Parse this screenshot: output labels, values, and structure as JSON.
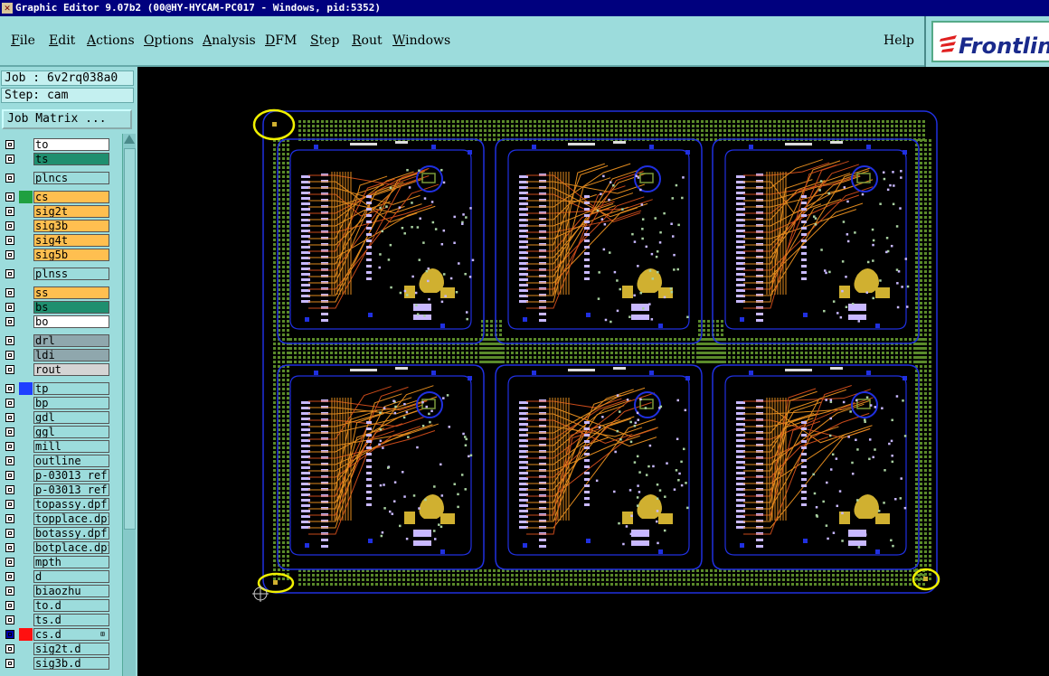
{
  "window": {
    "title": "Graphic Editor 9.07b2 (00@HY-HYCAM-PC017 - Windows, pid:5352)"
  },
  "menu": {
    "items": [
      {
        "label": "File",
        "mnemonic": "F"
      },
      {
        "label": "Edit",
        "mnemonic": "E"
      },
      {
        "label": "Actions",
        "mnemonic": "A"
      },
      {
        "label": "Options",
        "mnemonic": "O"
      },
      {
        "label": "Analysis",
        "mnemonic": "A"
      },
      {
        "label": "DFM",
        "mnemonic": "D"
      },
      {
        "label": "Step",
        "mnemonic": "S"
      },
      {
        "label": "Rout",
        "mnemonic": "R"
      },
      {
        "label": "Windows",
        "mnemonic": "W"
      }
    ],
    "help": "Help"
  },
  "logo": {
    "text": "Frontlin"
  },
  "panel": {
    "job": "Job : 6v2rq038a0",
    "step": "Step: cam",
    "job_matrix": "Job Matrix ..."
  },
  "layers": [
    {
      "name": "to",
      "color": "#ffffff",
      "swatch": "",
      "group": 0
    },
    {
      "name": "ts",
      "color": "#1f8f6f",
      "swatch": "",
      "group": 0
    },
    {
      "name": "plncs",
      "color": "#9cdcdc",
      "swatch": "",
      "group": 1
    },
    {
      "name": "cs",
      "color": "#ffbf50",
      "swatch": "#1fa040",
      "group": 2
    },
    {
      "name": "sig2t",
      "color": "#ffbf50",
      "swatch": "",
      "group": 2
    },
    {
      "name": "sig3b",
      "color": "#ffbf50",
      "swatch": "",
      "group": 2
    },
    {
      "name": "sig4t",
      "color": "#ffbf50",
      "swatch": "",
      "group": 2
    },
    {
      "name": "sig5b",
      "color": "#ffbf50",
      "swatch": "",
      "group": 2
    },
    {
      "name": "plnss",
      "color": "#9cdcdc",
      "swatch": "",
      "group": 3
    },
    {
      "name": "ss",
      "color": "#ffbf50",
      "swatch": "",
      "group": 4
    },
    {
      "name": "bs",
      "color": "#1f8f6f",
      "swatch": "",
      "group": 4
    },
    {
      "name": "bo",
      "color": "#ffffff",
      "swatch": "",
      "group": 4
    },
    {
      "name": "drl",
      "color": "#8fa7ad",
      "swatch": "",
      "group": 5
    },
    {
      "name": "ldi",
      "color": "#8fa7ad",
      "swatch": "",
      "group": 5
    },
    {
      "name": "rout",
      "color": "#d4d4d4",
      "swatch": "",
      "group": 5
    },
    {
      "name": "tp",
      "color": "#9cdcdc",
      "swatch": "#1f3fff",
      "group": 6
    },
    {
      "name": "bp",
      "color": "#9cdcdc",
      "swatch": "",
      "group": 6
    },
    {
      "name": "gdl",
      "color": "#9cdcdc",
      "swatch": "",
      "group": 6
    },
    {
      "name": "ggl",
      "color": "#9cdcdc",
      "swatch": "",
      "group": 6
    },
    {
      "name": "mill",
      "color": "#9cdcdc",
      "swatch": "",
      "group": 6
    },
    {
      "name": "outline",
      "color": "#9cdcdc",
      "swatch": "",
      "group": 6
    },
    {
      "name": "p-03013_ref",
      "color": "#9cdcdc",
      "swatch": "",
      "group": 6
    },
    {
      "name": "p-03013_ref",
      "color": "#9cdcdc",
      "swatch": "",
      "group": 6
    },
    {
      "name": "topassy.dpf",
      "color": "#9cdcdc",
      "swatch": "",
      "group": 6
    },
    {
      "name": "topplace.dpf",
      "color": "#9cdcdc",
      "swatch": "",
      "group": 6
    },
    {
      "name": "botassy.dpf",
      "color": "#9cdcdc",
      "swatch": "",
      "group": 6
    },
    {
      "name": "botplace.dpf",
      "color": "#9cdcdc",
      "swatch": "",
      "group": 6
    },
    {
      "name": "mpth",
      "color": "#9cdcdc",
      "swatch": "",
      "group": 6
    },
    {
      "name": "d",
      "color": "#9cdcdc",
      "swatch": "",
      "group": 6
    },
    {
      "name": "biaozhu",
      "color": "#9cdcdc",
      "swatch": "",
      "group": 6
    },
    {
      "name": "to.d",
      "color": "#9cdcdc",
      "swatch": "",
      "group": 6
    },
    {
      "name": "ts.d",
      "color": "#9cdcdc",
      "swatch": "",
      "group": 6
    },
    {
      "name": "cs.d",
      "color": "#9cdcdc",
      "swatch": "#ff1010",
      "group": 6,
      "selected": true
    },
    {
      "name": "sig2t.d",
      "color": "#9cdcdc",
      "swatch": "",
      "group": 6
    },
    {
      "name": "sig3b.d",
      "color": "#9cdcdc",
      "swatch": "",
      "group": 6
    }
  ],
  "colors": {
    "panel_bg": "#9cdcdc",
    "title_bg": "#00007e",
    "copper": "#e08a1e",
    "mask_green": "#5a8a2a",
    "outline_blue": "#2030e0",
    "fiducial_yellow": "#f0f000"
  }
}
